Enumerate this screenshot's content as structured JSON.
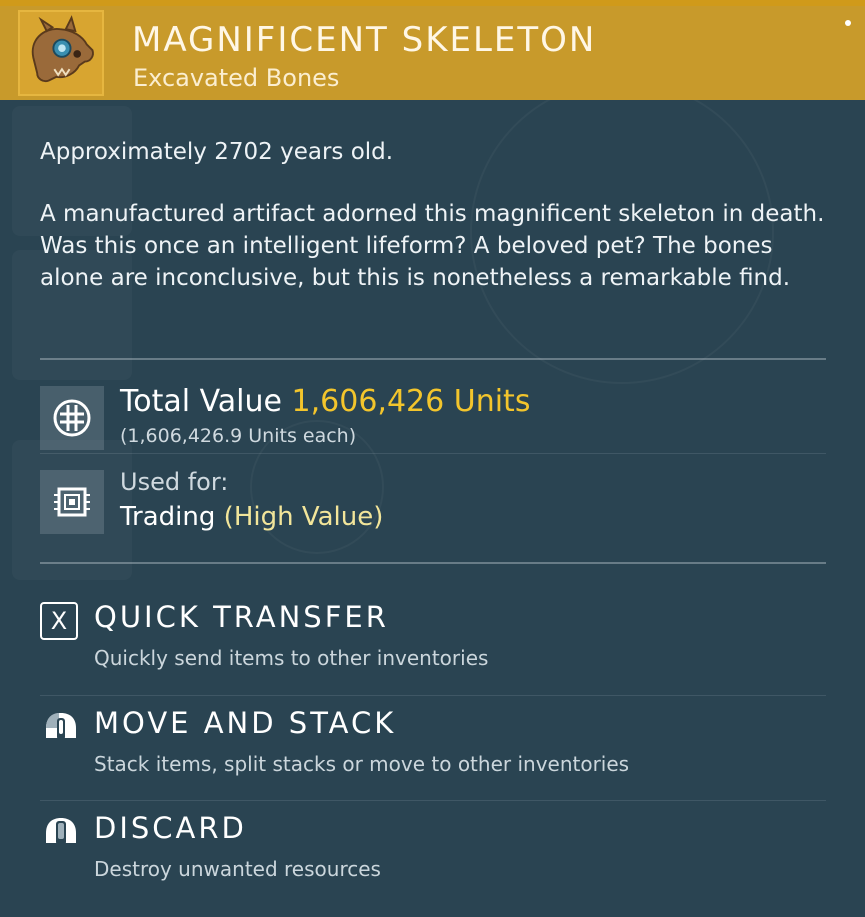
{
  "colors": {
    "header_bg": "#c89a2b",
    "value_accent": "#f3c52c",
    "trade_accent": "#f2e59a",
    "panel_bg": "#2a4452"
  },
  "item": {
    "name": "MAGNIFICENT SKELETON",
    "category": "Excavated Bones",
    "icon": "skull-icon"
  },
  "description": {
    "age_prefix": "Approximately",
    "age_value": "2702",
    "age_suffix": "years old.",
    "text": "A manufactured artifact adorned this magnificent skeleton in death. Was this once an intelligent lifeform? A beloved pet? The bones alone are inconclusive, but this is nonetheless a remarkable find."
  },
  "value": {
    "label": "Total Value",
    "amount": "1,606,426 Units",
    "each": "(1,606,426.9 Units each)",
    "icon": "units-icon"
  },
  "usage": {
    "label": "Used for:",
    "value": "Trading",
    "qualifier": "(High Value)",
    "icon": "trade-chip-icon"
  },
  "actions": [
    {
      "title": "QUICK TRANSFER",
      "description": "Quickly send items to other inventories",
      "icon": "x-key-icon",
      "key": "X"
    },
    {
      "title": "MOVE AND STACK",
      "description": "Stack items, split stacks or move to other inventories",
      "icon": "mouse-left-icon"
    },
    {
      "title": "DISCARD",
      "description": "Destroy unwanted resources",
      "icon": "mouse-middle-icon"
    }
  ]
}
